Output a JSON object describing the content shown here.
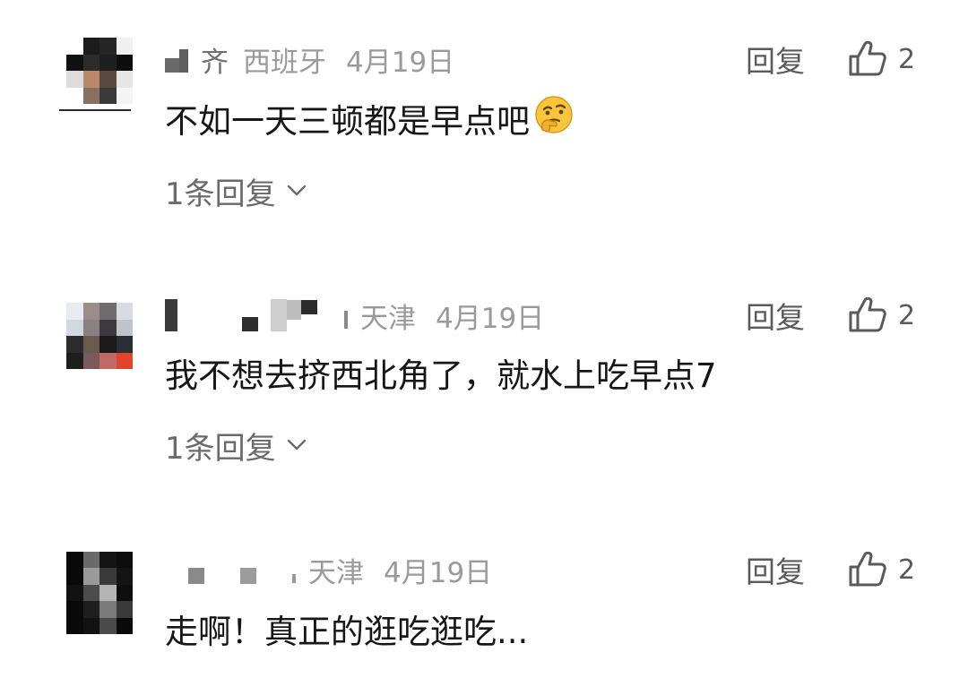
{
  "comments": [
    {
      "name_tail": "齐",
      "location": "西班牙",
      "date": "4月19日",
      "reply_label": "回复",
      "like_count": "2",
      "text": "不如一天三顿都是早点吧",
      "emoji_icon": "thinking-face-emoji-icon",
      "replies_label": "1条回复"
    },
    {
      "name_tail": "",
      "location": "天津",
      "date": "4月19日",
      "reply_label": "回复",
      "like_count": "2",
      "text": "我不想去挤西北角了，就水上吃早点7",
      "replies_label": "1条回复"
    },
    {
      "name_tail": "",
      "location": "天津",
      "date": "4月19日",
      "reply_label": "回复",
      "like_count": "2",
      "text": "走啊！真正的逛吃逛吃..."
    }
  ],
  "colors": {
    "meta_text": "#9a9a9a",
    "body_text": "#161616",
    "action_text": "#5a5a5a"
  }
}
